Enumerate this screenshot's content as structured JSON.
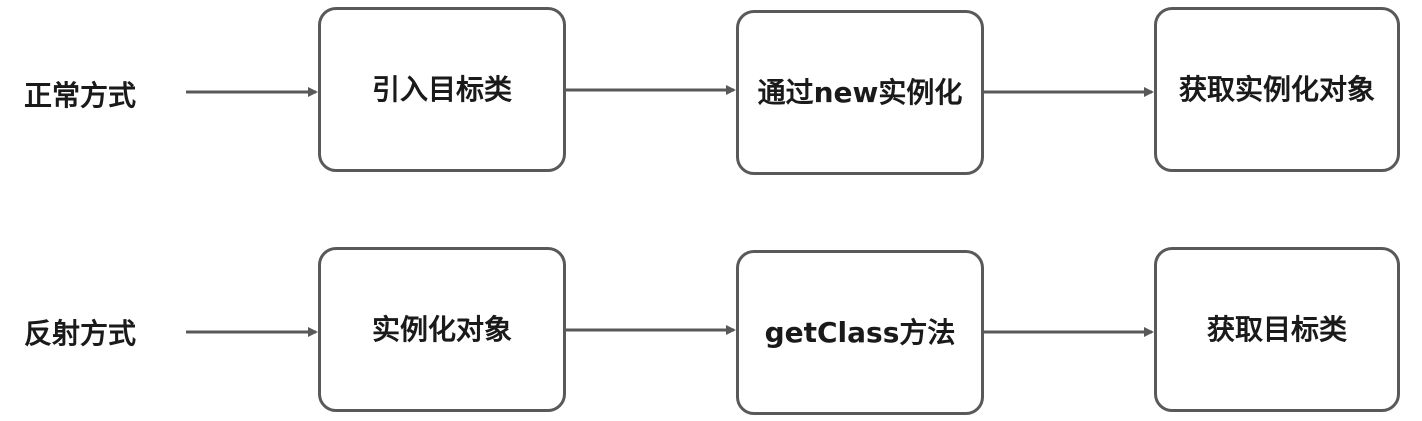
{
  "rows": [
    {
      "label": "正常方式",
      "steps": [
        "引入目标类",
        "通过new实例化",
        "获取实例化对象"
      ]
    },
    {
      "label": "反射方式",
      "steps": [
        "实例化对象",
        "getClass方法",
        "获取目标类"
      ]
    }
  ],
  "colors": {
    "border": "#595959",
    "arrow": "#595959",
    "text": "#1a1a1a",
    "background": "#ffffff"
  }
}
